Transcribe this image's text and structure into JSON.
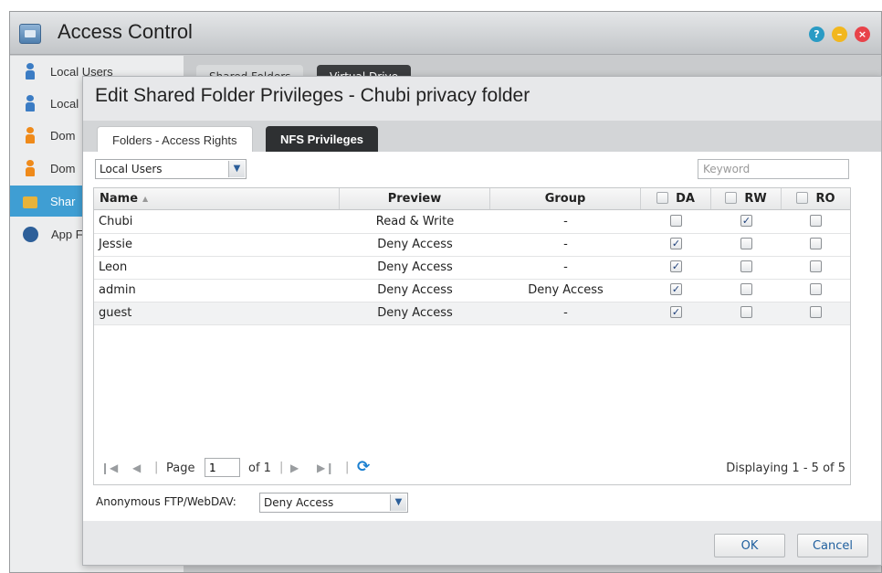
{
  "app": {
    "title": "Access Control"
  },
  "window_controls": {
    "help": "?",
    "minimize": "–",
    "close": "×"
  },
  "sidebar": {
    "items": [
      {
        "label": "Local Users"
      },
      {
        "label": "Local"
      },
      {
        "label": "Dom"
      },
      {
        "label": "Dom"
      },
      {
        "label": "Shar"
      },
      {
        "label": "App F"
      }
    ]
  },
  "background_tabs": [
    "Shared Folders",
    "Virtual Drive"
  ],
  "modal": {
    "title": "Edit Shared Folder Privileges - Chubi privacy folder",
    "tabs": [
      "Folders - Access Rights",
      "NFS Privileges"
    ],
    "user_type_select": "Local Users",
    "keyword_placeholder": "Keyword",
    "columns": {
      "name": "Name",
      "preview": "Preview",
      "group": "Group",
      "da": "DA",
      "rw": "RW",
      "ro": "RO"
    },
    "rows": [
      {
        "name": "Chubi",
        "preview": "Read & Write",
        "group": "-",
        "da": false,
        "rw": true,
        "ro": false
      },
      {
        "name": "Jessie",
        "preview": "Deny Access",
        "group": "-",
        "da": true,
        "rw": false,
        "ro": false
      },
      {
        "name": "Leon",
        "preview": "Deny Access",
        "group": "-",
        "da": true,
        "rw": false,
        "ro": false
      },
      {
        "name": "admin",
        "preview": "Deny Access",
        "group": "Deny Access",
        "da": true,
        "rw": false,
        "ro": false
      },
      {
        "name": "guest",
        "preview": "Deny Access",
        "group": "-",
        "da": true,
        "rw": false,
        "ro": false
      }
    ],
    "pager": {
      "page_label": "Page",
      "page_value": "1",
      "of_label": "of 1",
      "display_info": "Displaying 1 - 5 of 5"
    },
    "anonymous_label": "Anonymous FTP/WebDAV:",
    "anonymous_value": "Deny Access",
    "ok_label": "OK",
    "cancel_label": "Cancel"
  }
}
